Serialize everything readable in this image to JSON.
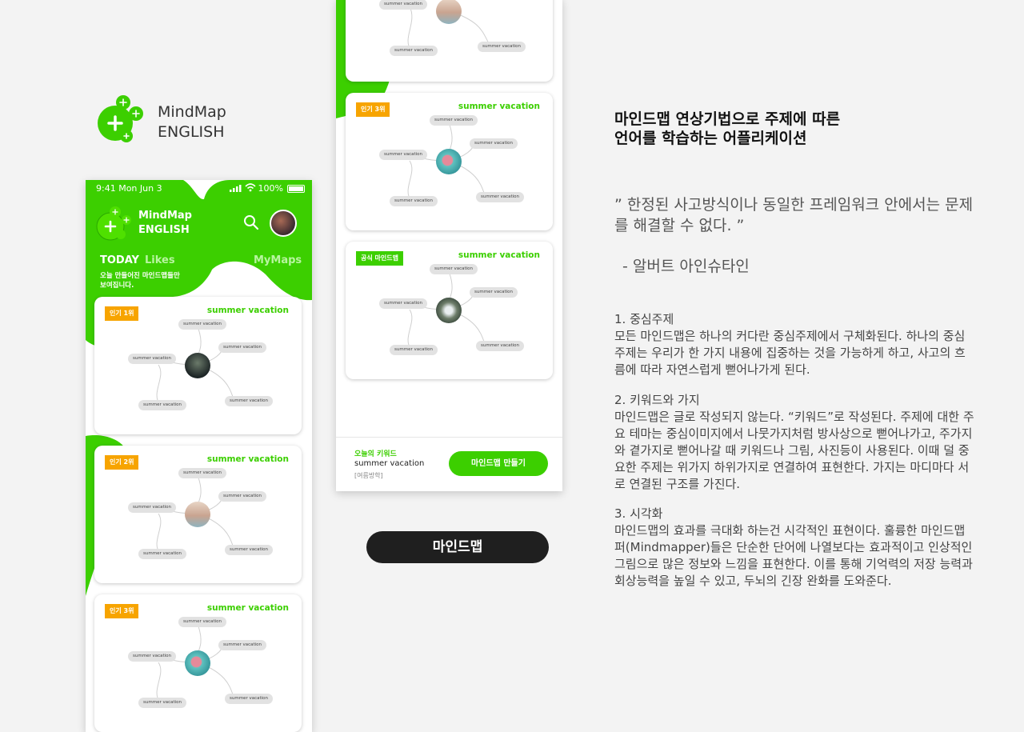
{
  "brand": {
    "name_line1": "MindMap",
    "name_line2": "ENGLISH"
  },
  "phone": {
    "status": {
      "time": "9:41  Mon Jun 3",
      "battery": "100%"
    },
    "app_title_line1": "MindMap",
    "app_title_line2": "ENGLISH",
    "tabs": {
      "today": "TODAY",
      "likes": "Likes",
      "mymaps": "MyMaps"
    },
    "tagline": "오늘 만들어진 마인드맵들만 보여집니다.",
    "cards": [
      {
        "rank": "인기 1위",
        "title": "summer vacation",
        "node": "summer vacation"
      },
      {
        "rank": "인기 2위",
        "title": "summer vacation",
        "node": "summer vacation"
      },
      {
        "rank": "인기 3위",
        "title": "summer vacation",
        "node": "summer vacation"
      }
    ]
  },
  "phone2": {
    "top_node": "summer vacation",
    "cards": [
      {
        "rank": "인기 3위",
        "title": "summer vacation",
        "node": "summer vacation"
      },
      {
        "rank": "공식 마인드맵",
        "title": "summer vacation",
        "node": "summer vacation"
      }
    ],
    "bottom": {
      "label": "오늘의 키워드",
      "keyword": "summer vacation",
      "translation": "[여름방학]",
      "button": "마인드맵 만들기"
    }
  },
  "pill_label": "마인드맵",
  "description": {
    "headline_line1": "마인드맵 연상기법으로 주제에 따른",
    "headline_line2": "언어를 학습하는 어플리케이션",
    "quote": "” 한정된 사고방식이나 동일한 프레임워크 안에서는 문제를 해결할 수 없다. ”",
    "author": "- 알버트 아인슈타인",
    "sections": [
      {
        "title": "1. 중심주제",
        "body": " 모든 마인드맵은 하나의 커다란 중심주제에서 구체화된다. 하나의 중심주제는 우리가 한 가지 내용에 집중하는 것을 가능하게 하고, 사고의 흐름에 따라 자연스럽게 뻗어나가게 된다."
      },
      {
        "title": "2. 키워드와 가지",
        "body": " 마인드맵은 글로 작성되지 않는다. “키워드”로 작성된다. 주제에 대한 주요 테마는 중심이미지에서 나뭇가지처럼 방사상으로 뻗어나가고, 주가지와 곁가지로 뻗어나갈 때 키워드나 그림, 사진등이 사용된다. 이때 덜 중요한 주제는 위가지 하위가지로 연결하여 표현한다. 가지는 마디마다 서로 연결된 구조를 가진다."
      },
      {
        "title": "3. 시각화",
        "body": " 마인드맵의 효과를 극대화 하는건 시각적인 표현이다. 훌륭한 마인드맵퍼(Mindmapper)들은 단순한 단어에 나열보다는 효과적이고 인상적인 그림으로 많은 정보와 느낌을 표현한다. 이를 통해 기억력의 저장 능력과 회상능력을 높일 수 있고, 두뇌의 긴장 완화를 도와준다."
      }
    ]
  },
  "colors": {
    "brand_green": "#3ccf00",
    "rank_orange": "#f7a400",
    "dark_pill": "#1f1f1f"
  }
}
